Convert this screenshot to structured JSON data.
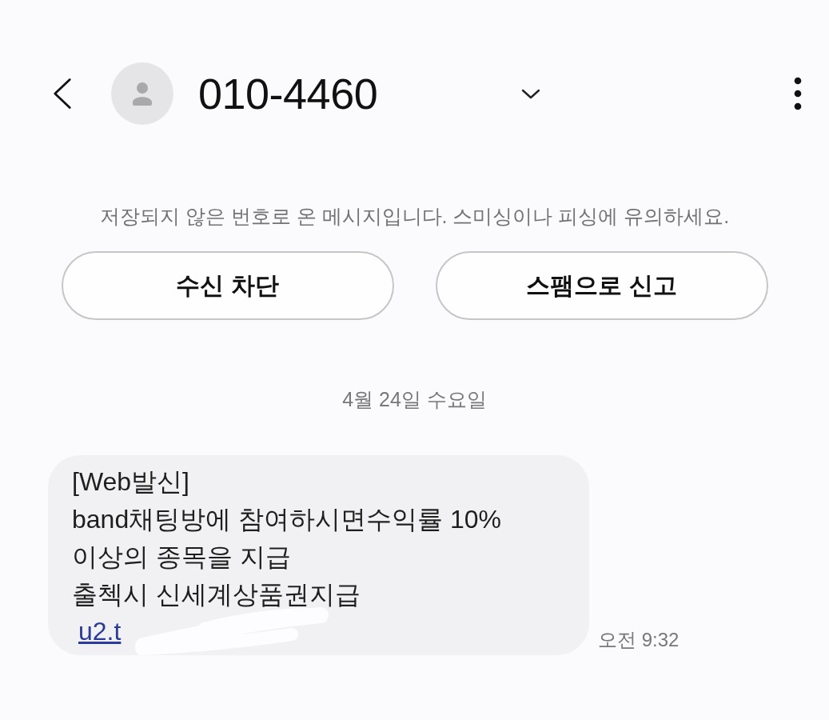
{
  "header": {
    "title": "010-4460"
  },
  "notice": {
    "text": "저장되지 않은 번호로 온 메시지입니다. 스미싱이나 피싱에 유의하세요.",
    "buttons": [
      "수신 차단",
      "스팸으로 신고"
    ]
  },
  "conversation": {
    "date": "4월 24일 수요일",
    "messages": [
      {
        "text": "[Web발신]\nband채팅방에 참여하시면수익률 10%\n이상의 종목을 지급\n출첵시 신세계상품권지급",
        "link": "u2.t",
        "redacted": true,
        "time": "오전 9:32"
      }
    ]
  }
}
